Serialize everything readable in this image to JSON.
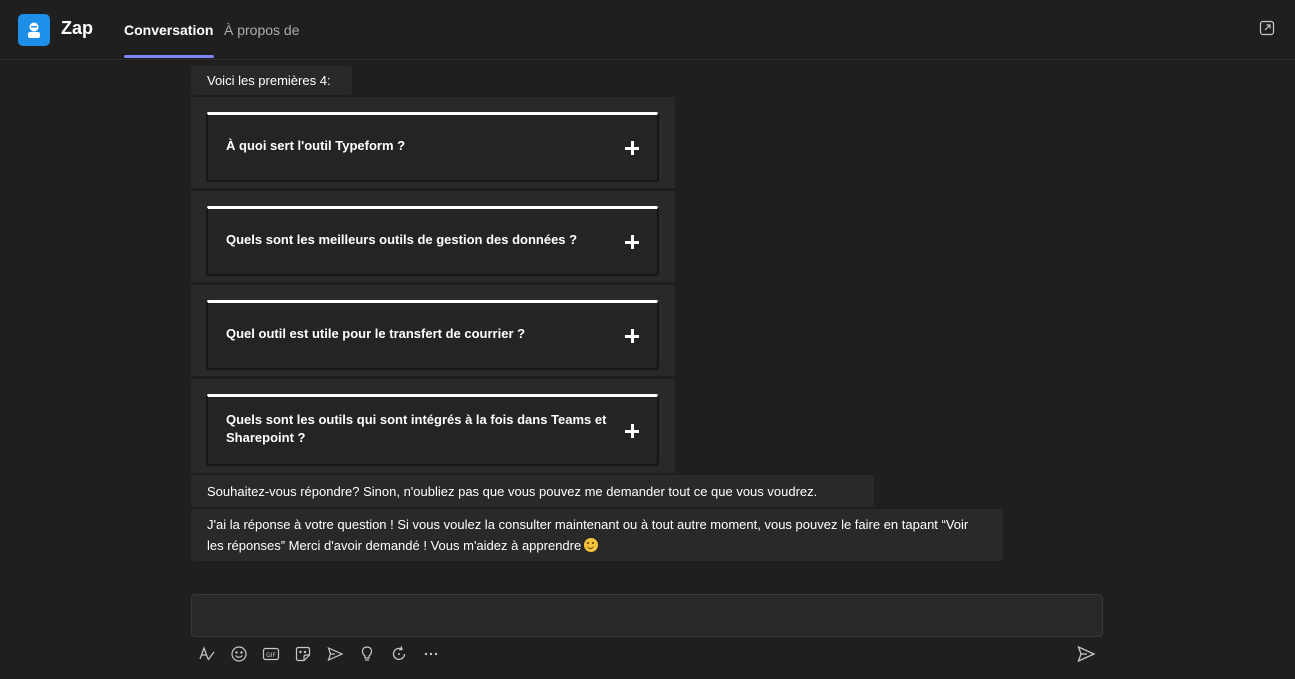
{
  "app": {
    "title": "Zap",
    "icon": "bot-icon",
    "accent": "#1e8fe8"
  },
  "tabs": [
    {
      "label": "Conversation",
      "active": true
    },
    {
      "label": "À propos de",
      "active": false
    }
  ],
  "header_actions": {
    "popout_icon": "popout-icon"
  },
  "messages": {
    "intro": "Voici les premières 4:",
    "faq_cards": [
      {
        "question": "À quoi sert l'outil Typeform ?"
      },
      {
        "question": "Quels sont les meilleurs outils de gestion des données ?"
      },
      {
        "question": "Quel outil est utile pour le transfert de courrier ?"
      },
      {
        "question": "Quels sont les outils qui sont intégrés à la fois dans Teams et Sharepoint ?"
      }
    ],
    "prompt": "Souhaitez-vous répondre? Sinon, n'oubliez pas que vous pouvez me demander tout ce que vous voudrez.",
    "answer": "J'ai la réponse à votre question ! Si vous voulez la consulter maintenant ou à tout autre moment, vous pouvez le faire en tapant “Voir les réponses” Merci d'avoir demandé ! Vous m'aidez à apprendre"
  },
  "compose": {
    "value": "",
    "toolbar_icons": [
      "format-icon",
      "emoji-icon",
      "gif-icon",
      "sticker-icon",
      "schedule-send-icon",
      "praise-icon",
      "loop-icon",
      "more-icon"
    ],
    "send_icon": "send-icon"
  },
  "colors": {
    "background": "#1f1f1f",
    "bubble": "#292929",
    "tab_underline": "#7f85f5"
  }
}
